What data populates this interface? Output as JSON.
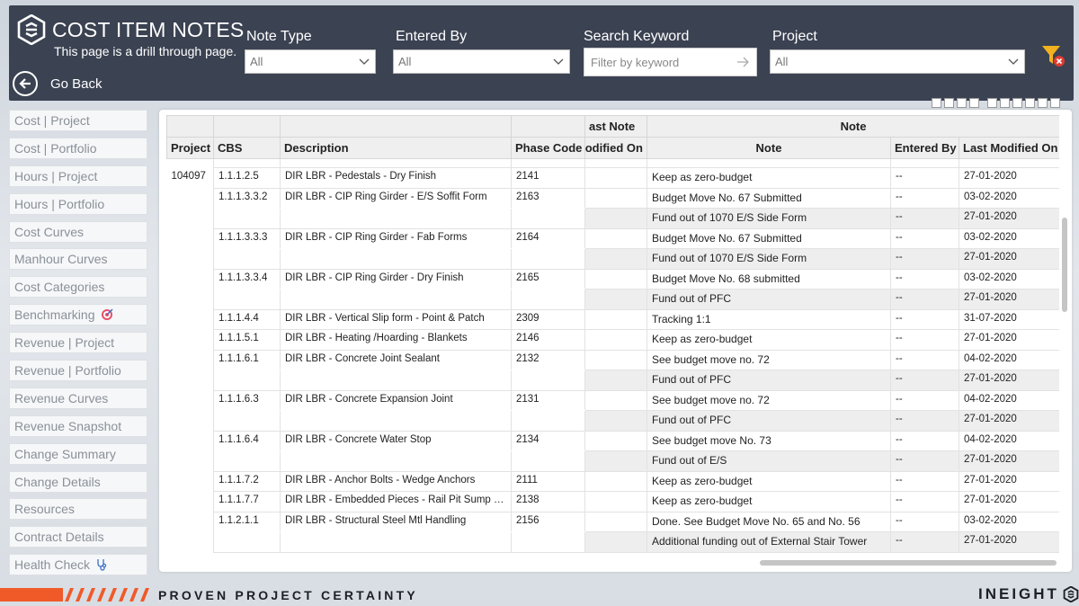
{
  "header": {
    "title": "COST ITEM NOTES",
    "subtitle": "This page is a drill through page.",
    "back_label": "Go Back"
  },
  "filters": {
    "note_type": {
      "label": "Note Type",
      "value": "All"
    },
    "entered_by": {
      "label": "Entered By",
      "value": "All"
    },
    "search": {
      "label": "Search Keyword",
      "placeholder": "Filter by keyword"
    },
    "project": {
      "label": "Project",
      "value": "All"
    }
  },
  "sidebar": {
    "items": [
      {
        "label": "Cost | Project"
      },
      {
        "label": "Cost | Portfolio"
      },
      {
        "label": "Hours | Project"
      },
      {
        "label": "Hours | Portfolio"
      },
      {
        "label": "Cost Curves"
      },
      {
        "label": "Manhour Curves"
      },
      {
        "label": "Cost Categories"
      },
      {
        "label": "Benchmarking",
        "icon": "target-icon"
      },
      {
        "label": "Revenue | Project"
      },
      {
        "label": "Revenue | Portfolio"
      },
      {
        "label": "Revenue Curves"
      },
      {
        "label": "Revenue Snapshot"
      },
      {
        "label": "Change Summary"
      },
      {
        "label": "Change Details"
      },
      {
        "label": "Resources"
      },
      {
        "label": "Contract Details"
      },
      {
        "label": "Health Check",
        "icon": "stethoscope-icon"
      }
    ]
  },
  "table": {
    "group_headers": {
      "last_note": "ast Note",
      "note": "Note"
    },
    "columns": {
      "project": "Project",
      "cbs": "CBS",
      "description": "Description",
      "phase_code": "Phase Code",
      "last_modified_partial": "odified On",
      "note": "Note",
      "entered_by": "Entered By",
      "last_modified": "Last Modified On"
    },
    "project_value": "104097",
    "rows": [
      {
        "cbs": "1.1.1.2.5",
        "desc": "DIR LBR - Pedestals - Dry Finish",
        "phase": "2141",
        "notes": [
          {
            "note": "Keep as zero-budget",
            "by": "--",
            "date": "27-01-2020"
          }
        ]
      },
      {
        "cbs": "1.1.1.3.3.2",
        "desc": "DIR LBR - CIP Ring Girder - E/S Soffit Form",
        "phase": "2163",
        "notes": [
          {
            "note": "Budget Move No. 67 Submitted",
            "by": "--",
            "date": "03-02-2020"
          },
          {
            "note": "Fund out of 1070 E/S Side Form",
            "by": "--",
            "date": "27-01-2020"
          }
        ]
      },
      {
        "cbs": "1.1.1.3.3.3",
        "desc": "DIR LBR - CIP Ring Girder - Fab Forms",
        "phase": "2164",
        "notes": [
          {
            "note": "Budget Move No. 67 Submitted",
            "by": "--",
            "date": "03-02-2020"
          },
          {
            "note": "Fund out of 1070 E/S Side Form",
            "by": "--",
            "date": "27-01-2020"
          }
        ]
      },
      {
        "cbs": "1.1.1.3.3.4",
        "desc": "DIR LBR - CIP Ring Girder - Dry Finish",
        "phase": "2165",
        "notes": [
          {
            "note": "Budget Move No. 68 submitted",
            "by": "--",
            "date": "03-02-2020"
          },
          {
            "note": "Fund out of PFC",
            "by": "--",
            "date": "27-01-2020"
          }
        ]
      },
      {
        "cbs": "1.1.1.4.4",
        "desc": "DIR LBR - Vertical Slip form - Point & Patch",
        "phase": "2309",
        "notes": [
          {
            "note": "Tracking 1:1",
            "by": "--",
            "date": "31-07-2020"
          }
        ]
      },
      {
        "cbs": "1.1.1.5.1",
        "desc": "DIR LBR - Heating /Hoarding - Blankets",
        "phase": "2146",
        "notes": [
          {
            "note": "Keep as zero-budget",
            "by": "--",
            "date": "27-01-2020"
          }
        ]
      },
      {
        "cbs": "1.1.1.6.1",
        "desc": "DIR LBR - Concrete Joint Sealant",
        "phase": "2132",
        "notes": [
          {
            "note": "See budget move no. 72",
            "by": "--",
            "date": "04-02-2020"
          },
          {
            "note": "Fund out of PFC",
            "by": "--",
            "date": "27-01-2020"
          }
        ]
      },
      {
        "cbs": "1.1.1.6.3",
        "desc": "DIR LBR - Concrete Expansion Joint",
        "phase": "2131",
        "notes": [
          {
            "note": "See budget move no. 72",
            "by": "--",
            "date": "04-02-2020"
          },
          {
            "note": "Fund out of PFC",
            "by": "--",
            "date": "27-01-2020"
          }
        ]
      },
      {
        "cbs": "1.1.1.6.4",
        "desc": "DIR LBR - Concrete Water Stop",
        "phase": "2134",
        "notes": [
          {
            "note": "See budget move No. 73",
            "by": "--",
            "date": "04-02-2020"
          },
          {
            "note": "Fund out of E/S",
            "by": "--",
            "date": "27-01-2020"
          }
        ]
      },
      {
        "cbs": "1.1.1.7.2",
        "desc": "DIR LBR - Anchor Bolts - Wedge Anchors",
        "phase": "2111",
        "notes": [
          {
            "note": "Keep as zero-budget",
            "by": "--",
            "date": "27-01-2020"
          }
        ]
      },
      {
        "cbs": "1.1.1.7.7",
        "desc": "DIR LBR - Embedded Pieces - Rail Pit Sump and...",
        "phase": "2138",
        "notes": [
          {
            "note": "Keep as zero-budget",
            "by": "--",
            "date": "27-01-2020"
          }
        ]
      },
      {
        "cbs": "1.1.2.1.1",
        "desc": "DIR LBR - Structural Steel Mtl Handling",
        "phase": "2156",
        "notes": [
          {
            "note": "Done. See Budget Move No. 65 and No. 56",
            "by": "--",
            "date": "03-02-2020"
          },
          {
            "note": "Additional funding out of External Stair Tower",
            "by": "--",
            "date": "27-01-2020"
          }
        ]
      }
    ]
  },
  "footer": {
    "tagline": "PROVEN PROJECT CERTAINTY",
    "brand": "INEIGHT"
  },
  "colors": {
    "header_bg": "#3b4252",
    "accent_orange": "#f05a28",
    "filter_icon": "#f2b21f",
    "filter_clear": "#e03c31"
  }
}
